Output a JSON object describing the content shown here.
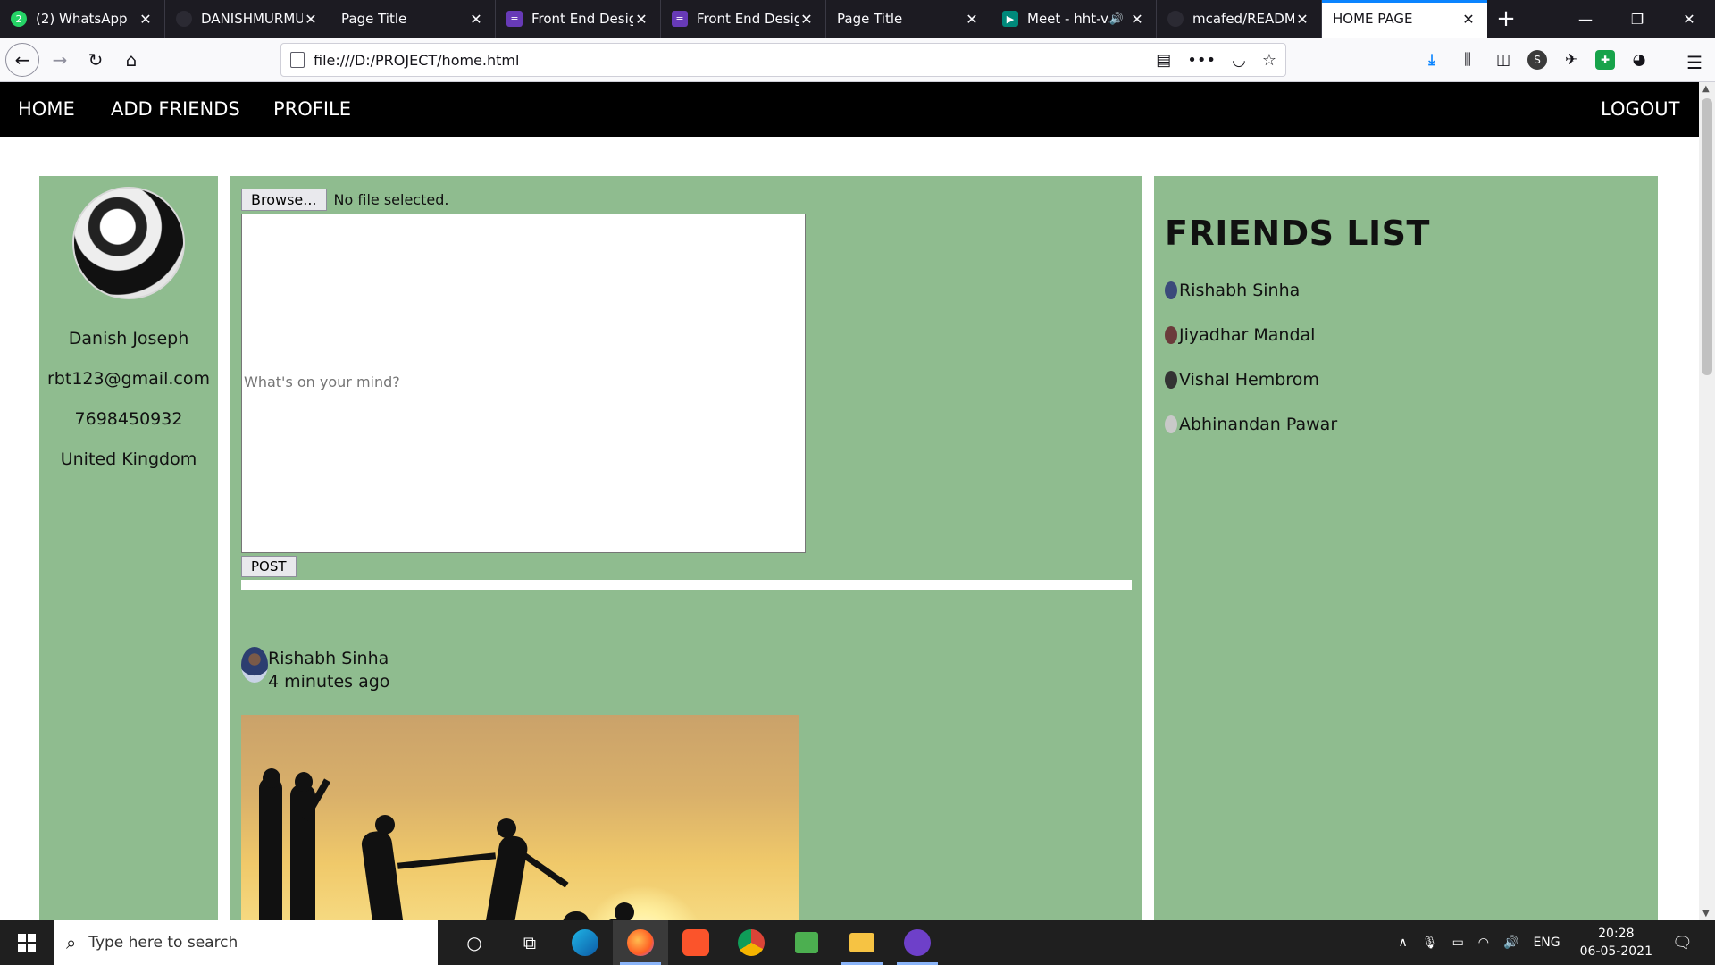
{
  "browser": {
    "tabs": [
      {
        "label": "(2) WhatsApp",
        "favicon": "whatsapp-icon",
        "favicon_text": "2",
        "favicon_color": "#25d366",
        "active": false
      },
      {
        "label": "DANISHMURMU",
        "favicon": "github-icon",
        "favicon_text": "",
        "favicon_color": "#2b2a33",
        "active": false
      },
      {
        "label": "Page Title",
        "favicon": "",
        "favicon_text": "",
        "favicon_color": "",
        "active": false
      },
      {
        "label": "Front End Design",
        "favicon": "forms-icon",
        "favicon_text": "≡",
        "favicon_color": "#673ab7",
        "active": false
      },
      {
        "label": "Front End Design",
        "favicon": "forms-icon",
        "favicon_text": "≡",
        "favicon_color": "#673ab7",
        "active": false
      },
      {
        "label": "Page Title",
        "favicon": "",
        "favicon_text": "",
        "favicon_color": "",
        "active": false
      },
      {
        "label": "Meet - hht-vs",
        "favicon": "meet-icon",
        "favicon_text": "▶",
        "favicon_color": "#00897b",
        "active": false,
        "audio": true
      },
      {
        "label": "mcafed/README",
        "favicon": "github-icon",
        "favicon_text": "",
        "favicon_color": "#2b2a33",
        "active": false
      },
      {
        "label": "HOME PAGE",
        "favicon": "",
        "favicon_text": "",
        "favicon_color": "",
        "active": true
      }
    ],
    "url": "file:///D:/PROJECT/home.html",
    "accent_color": "#0a84ff"
  },
  "site": {
    "nav": {
      "home": "HOME",
      "add_friends": "ADD FRIENDS",
      "profile": "PROFILE",
      "logout": "LOGOUT"
    },
    "profile": {
      "name": "Danish Joseph",
      "email": "rbt123@gmail.com",
      "phone": "7698450932",
      "country": "United Kingdom"
    },
    "composer": {
      "browse_label": "Browse...",
      "file_status": "No file selected.",
      "placeholder": "What's on your mind?",
      "post_label": "POST"
    },
    "post": {
      "author": "Rishabh Sinha",
      "time": "4 minutes ago"
    },
    "friends": {
      "title": "FRIENDS LIST",
      "items": [
        {
          "name": "Rishabh Sinha",
          "color": "#3b4a7a"
        },
        {
          "name": "Jiyadhar Mandal",
          "color": "#6b3b3b"
        },
        {
          "name": "Vishal Hembrom",
          "color": "#333333"
        },
        {
          "name": "Abhinandan Pawar",
          "color": "#c9c9c9"
        }
      ]
    },
    "panel_color": "#8fbc8f"
  },
  "taskbar": {
    "search_placeholder": "Type here to search",
    "language": "ENG",
    "time": "20:28",
    "date": "06-05-2021"
  }
}
